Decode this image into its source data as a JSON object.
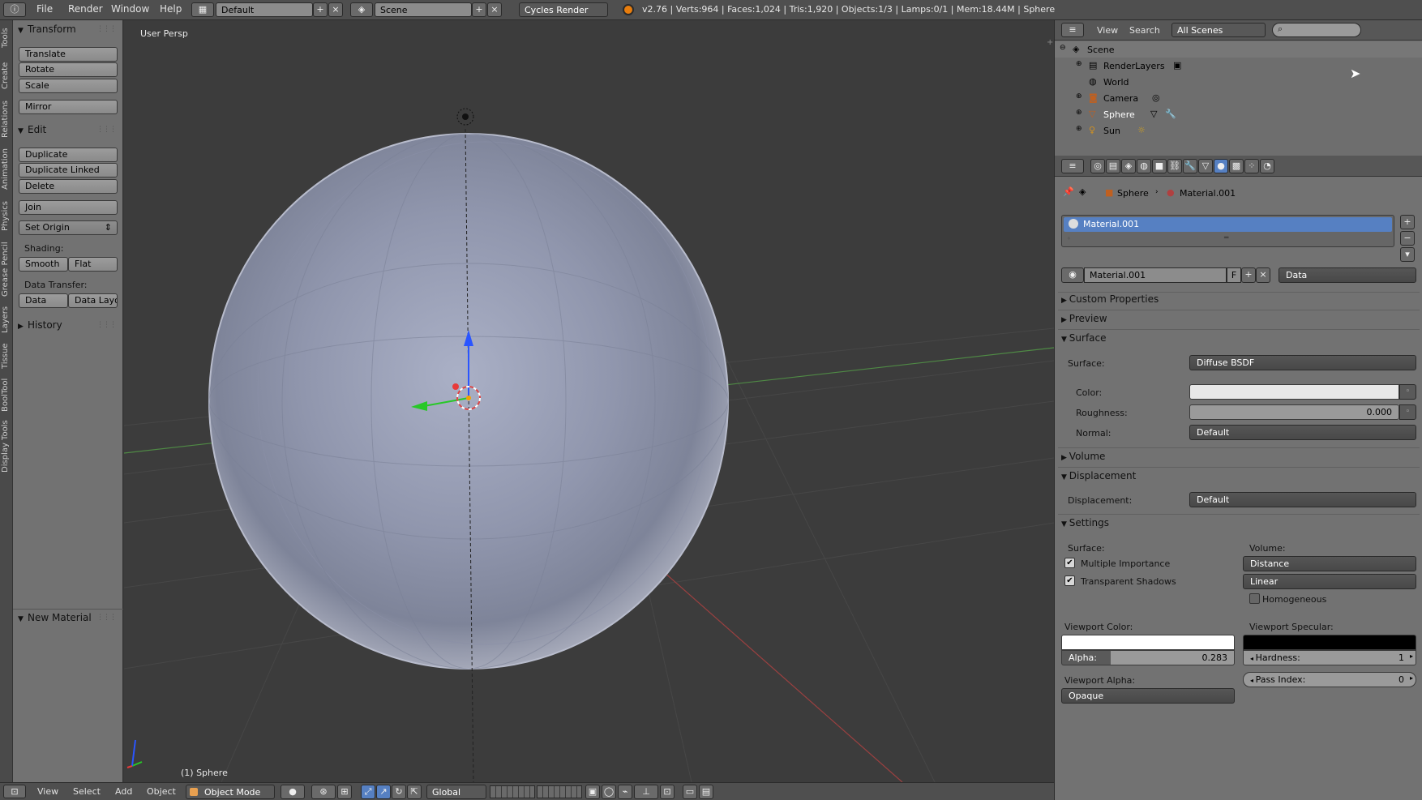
{
  "topbar": {
    "menus": [
      "File",
      "Render",
      "Window",
      "Help"
    ],
    "layout_value": "Default",
    "scene_value": "Scene",
    "engine_value": "Cycles Render",
    "stats": "v2.76 | Verts:964 | Faces:1,024 | Tris:1,920 | Objects:1/3 | Lamps:0/1 | Mem:18.44M | Sphere"
  },
  "vtabs": [
    "Tools",
    "Create",
    "Relations",
    "Animation",
    "Physics",
    "Grease Pencil",
    "Layers",
    "Tissue",
    "BoolTool",
    "Display Tools"
  ],
  "toolshelf": {
    "transform_title": "Transform",
    "translate": "Translate",
    "rotate": "Rotate",
    "scale": "Scale",
    "mirror": "Mirror",
    "edit_title": "Edit",
    "duplicate": "Duplicate",
    "duplicate_linked": "Duplicate Linked",
    "delete": "Delete",
    "join": "Join",
    "set_origin": "Set Origin",
    "shading_label": "Shading:",
    "smooth": "Smooth",
    "flat": "Flat",
    "data_transfer_label": "Data Transfer:",
    "data": "Data",
    "data_layout": "Data Layo",
    "history_title": "History",
    "new_material_title": "New Material"
  },
  "viewport": {
    "view_label": "User Persp",
    "object_label": "(1) Sphere"
  },
  "bottombar": {
    "view": "View",
    "select": "Select",
    "add": "Add",
    "object": "Object",
    "mode": "Object Mode",
    "orientation": "Global"
  },
  "outliner": {
    "view": "View",
    "search": "Search",
    "filter": "All Scenes",
    "items": [
      "Scene",
      "RenderLayers",
      "World",
      "Camera",
      "Sphere",
      "Sun"
    ]
  },
  "properties": {
    "breadcrumb_object": "Sphere",
    "breadcrumb_material": "Material.001",
    "slot_name": "Material.001",
    "material_name": "Material.001",
    "fake_user": "F",
    "link_value": "Data",
    "custom_properties": "Custom Properties",
    "preview": "Preview",
    "surface_section": "Surface",
    "surface_label": "Surface:",
    "surface_value": "Diffuse BSDF",
    "color_label": "Color:",
    "roughness_label": "Roughness:",
    "roughness_value": "0.000",
    "normal_label": "Normal:",
    "normal_value": "Default",
    "volume_section": "Volume",
    "displacement_section": "Displacement",
    "displacement_label": "Displacement:",
    "displacement_value": "Default",
    "settings_section": "Settings",
    "settings_surface": "Surface:",
    "settings_volume": "Volume:",
    "multiple_importance": "Multiple Importance",
    "transparent_shadows": "Transparent Shadows",
    "volume_sampling": "Distance",
    "volume_interpolation": "Linear",
    "homogeneous": "Homogeneous",
    "viewport_color": "Viewport Color:",
    "viewport_specular": "Viewport Specular:",
    "alpha_label": "Alpha:",
    "alpha_value": "0.283",
    "hardness_label": "Hardness:",
    "hardness_value": "1",
    "viewport_alpha": "Viewport Alpha:",
    "pass_index_label": "Pass Index:",
    "pass_index_value": "0",
    "viewport_alpha_value": "Opaque"
  },
  "colors": {
    "selection": "#5680c2",
    "material_color": "#e8e8e8",
    "viewport_color": "#ffffff",
    "viewport_specular": "#000000"
  }
}
